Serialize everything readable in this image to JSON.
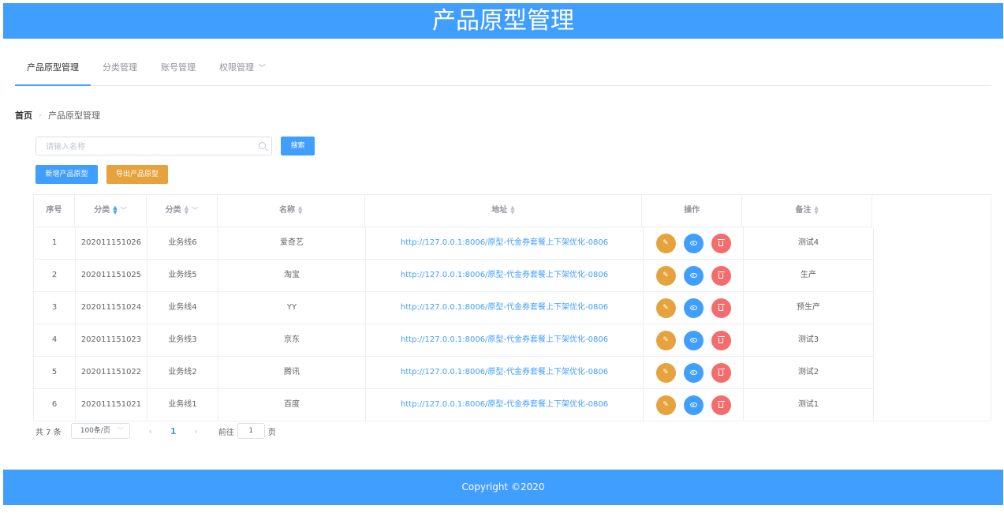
{
  "header": {
    "title": "产品原型管理"
  },
  "nav": {
    "items": [
      {
        "label": "产品原型管理"
      },
      {
        "label": "分类管理"
      },
      {
        "label": "账号管理"
      },
      {
        "label": "权限管理"
      }
    ]
  },
  "breadcrumb": {
    "home": "首页",
    "current": "产品原型管理"
  },
  "search": {
    "placeholder": "请输入名称",
    "button_label": "搜索"
  },
  "actions": {
    "add_label": "新增产品原型",
    "export_label": "导出产品原型"
  },
  "table": {
    "columns": [
      "序号",
      "分类",
      "分类",
      "名称",
      "地址",
      "操作",
      "备注"
    ],
    "rows": [
      {
        "index": "1",
        "code": "202011151026",
        "category": "业务线6",
        "name": "爱奇艺",
        "url": "http://127.0.0.1:8006/原型-代金券套餐上下架优化-0806",
        "note": "测试4"
      },
      {
        "index": "2",
        "code": "202011151025",
        "category": "业务线5",
        "name": "淘宝",
        "url": "http://127.0.0.1:8006/原型-代金券套餐上下架优化-0806",
        "note": "生产"
      },
      {
        "index": "3",
        "code": "202011151024",
        "category": "业务线4",
        "name": "YY",
        "url": "http://127.0.0.1:8006/原型-代金券套餐上下架优化-0806",
        "note": "预生产"
      },
      {
        "index": "4",
        "code": "202011151023",
        "category": "业务线3",
        "name": "京东",
        "url": "http://127.0.0.1:8006/原型-代金券套餐上下架优化-0806",
        "note": "测试3"
      },
      {
        "index": "5",
        "code": "202011151022",
        "category": "业务线2",
        "name": "腾讯",
        "url": "http://127.0.0.1:8006/原型-代金券套餐上下架优化-0806",
        "note": "测试2"
      },
      {
        "index": "6",
        "code": "202011151021",
        "category": "业务线1",
        "name": "百度",
        "url": "http://127.0.0.1:8006/原型-代金券套餐上下架优化-0806",
        "note": "测试1"
      }
    ]
  },
  "pagination": {
    "total": "共 7 条",
    "page_size": "100条/页",
    "current_page": "1",
    "goto_label": "前往",
    "goto_value": "1",
    "page_suffix": "页"
  },
  "footer": {
    "copyright": "Copyright ©2020"
  },
  "colors": {
    "primary": "#409eff",
    "warning": "#e6a23c",
    "danger": "#f56c6c"
  }
}
